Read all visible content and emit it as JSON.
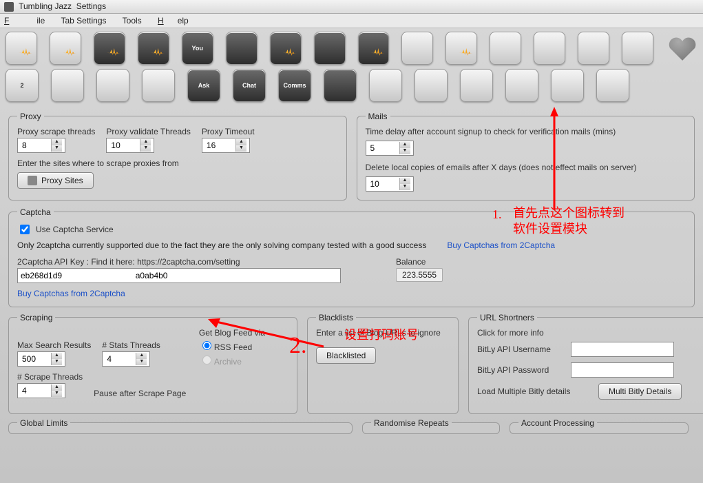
{
  "titlebar": {
    "app": "Tumbling Jazz",
    "section": "Settings"
  },
  "menu": {
    "file": "File",
    "tabsettings": "Tab Settings",
    "tools": "Tools",
    "help": "Help"
  },
  "toolbar_row1": [
    {
      "name": "notes-icon",
      "style": "light orange-accent"
    },
    {
      "name": "notes2-icon",
      "style": "light orange-accent"
    },
    {
      "name": "image-rss-icon",
      "style": "dark orange-accent"
    },
    {
      "name": "globe-rss-icon",
      "style": "dark orange-accent"
    },
    {
      "name": "youtube-icon",
      "style": "dark",
      "txt": "You"
    },
    {
      "name": "clapper-icon",
      "style": "dark"
    },
    {
      "name": "clapper-rss-icon",
      "style": "dark orange-accent"
    },
    {
      "name": "soundcloud-icon",
      "style": "dark"
    },
    {
      "name": "soundcloud-rss-icon",
      "style": "dark orange-accent"
    },
    {
      "name": "link-icon",
      "style": "light"
    },
    {
      "name": "link-rss-icon",
      "style": "light orange-accent"
    },
    {
      "name": "redo-icon",
      "style": "light"
    },
    {
      "name": "recycle-icon",
      "style": "light"
    },
    {
      "name": "user-add-icon",
      "style": "light"
    },
    {
      "name": "user-remove-icon",
      "style": "light"
    },
    {
      "name": "heart-icon",
      "style": "heart"
    }
  ],
  "toolbar_row2": [
    {
      "name": "two-icon",
      "style": "light",
      "txt": "2"
    },
    {
      "name": "calendar-icon",
      "style": "light"
    },
    {
      "name": "list-icon",
      "style": "light"
    },
    {
      "name": "wifi-icon",
      "style": "light"
    },
    {
      "name": "ask-icon",
      "style": "dark",
      "txt": "Ask"
    },
    {
      "name": "chat-icon",
      "style": "dark",
      "txt": "Chat"
    },
    {
      "name": "comms-icon",
      "style": "dark",
      "txt": "Comms"
    },
    {
      "name": "eye-icon",
      "style": "dark"
    },
    {
      "name": "satellite-icon",
      "style": "light"
    },
    {
      "name": "search-icon",
      "style": "light"
    },
    {
      "name": "picture-icon",
      "style": "light"
    },
    {
      "name": "stats-icon",
      "style": "light"
    },
    {
      "name": "gear-settings-icon",
      "style": "light"
    },
    {
      "name": "robot-icon",
      "style": "light"
    }
  ],
  "proxy": {
    "legend": "Proxy",
    "scrape_label": "Proxy scrape threads",
    "scrape_val": "8",
    "validate_label": "Proxy validate Threads",
    "validate_val": "10",
    "timeout_label": "Proxy Timeout",
    "timeout_val": "16",
    "sites_label": "Enter the sites where to scrape proxies from",
    "sites_btn": "Proxy Sites"
  },
  "mails": {
    "legend": "Mails",
    "delay_label": "Time delay after account signup to check for verification mails (mins)",
    "delay_val": "5",
    "delete_label": "Delete local copies of emails after X days (does not effect mails on server)",
    "delete_val": "10"
  },
  "captcha": {
    "legend": "Captcha",
    "use_label": "Use Captcha Service",
    "note": "Only 2captcha currently supported due to the fact they are the only solving company tested with a good success",
    "buy_link": "Buy Captchas from 2Captcha",
    "api_label": "2Captcha API Key : Find it here: https://2captcha.com/setting",
    "api_val": "eb268d1d9                                a0ab4b0",
    "balance_label": "Balance",
    "balance_val": "223.5555",
    "buy_link2": "Buy Captchas from 2Captcha"
  },
  "scraping": {
    "legend": "Scraping",
    "max_label": "Max Search Results",
    "max_val": "500",
    "stats_label": "# Stats Threads",
    "stats_val": "4",
    "feed_label": "Get Blog Feed via",
    "rss": "RSS Feed",
    "archive": "Archive",
    "scrape_threads_label": "# Scrape Threads",
    "scrape_threads_val": "4",
    "pause_label": "Pause after Scrape Page"
  },
  "blacklists": {
    "legend": "Blacklists",
    "label": "Enter a list of Blog URLs to ignore",
    "btn": "Blacklisted"
  },
  "shorteners": {
    "legend": "URL Shortners",
    "click": "Click for more info",
    "user_label": "BitLy API Username",
    "pass_label": "BitLy API Password",
    "load_label": "Load Multiple Bitly details",
    "btn": "Multi Bitly Details"
  },
  "bottom": {
    "global": "Global Limits",
    "randomise": "Randomise Repeats",
    "account": "Account Processing"
  },
  "annotations": {
    "a1_num": "1.",
    "a1_text": "首先点这个图标转到\n软件设置模块",
    "a2_num": "2.",
    "a2_text": "设置打码账号"
  }
}
